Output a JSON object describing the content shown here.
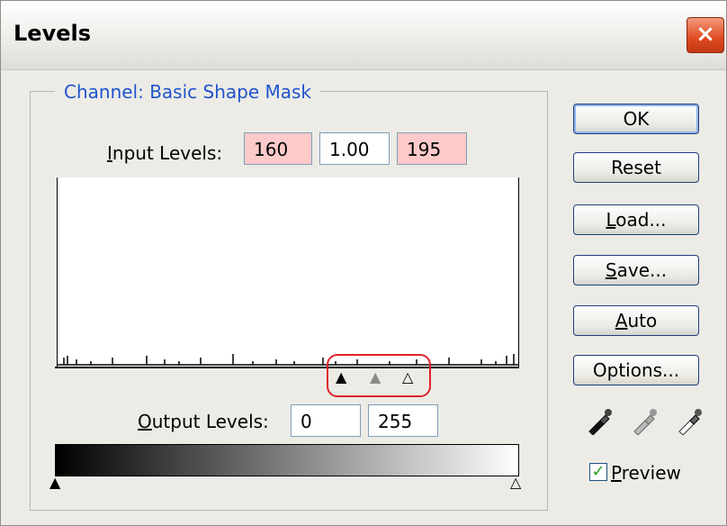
{
  "window": {
    "title": "Levels",
    "close_glyph": "×"
  },
  "channel": {
    "legend": "Channel:  Basic Shape Mask"
  },
  "input_levels": {
    "label_mnemonic": "I",
    "label_rest": "nput Levels:",
    "black": "160",
    "gamma": "1.00",
    "white": "195"
  },
  "output_levels": {
    "label_mnemonic": "O",
    "label_rest": "utput Levels:",
    "black": "0",
    "white": "255"
  },
  "buttons": {
    "ok": "OK",
    "reset": "Reset",
    "load_mnemonic": "L",
    "load_rest": "oad...",
    "save_mnemonic": "S",
    "save_rest": "ave...",
    "auto_mnemonic": "A",
    "auto_rest": "uto",
    "options": "Options..."
  },
  "preview": {
    "checked": true,
    "label_mnemonic": "P",
    "label_rest": "review",
    "check_glyph": "✓"
  },
  "histogram_ticks": [
    0,
    8,
    12,
    22,
    38,
    62,
    100,
    120,
    136,
    160,
    196,
    218,
    244,
    264,
    296,
    310,
    334,
    370,
    400,
    436,
    472,
    488,
    500,
    508,
    514
  ],
  "colors": {
    "accent_text": "#1f53cc",
    "highlight_ring": "#e0222a",
    "field_highlight": "#fdcaca"
  },
  "icons": [
    "set-black-point-eyedropper-icon",
    "set-gray-point-eyedropper-icon",
    "set-white-point-eyedropper-icon"
  ]
}
